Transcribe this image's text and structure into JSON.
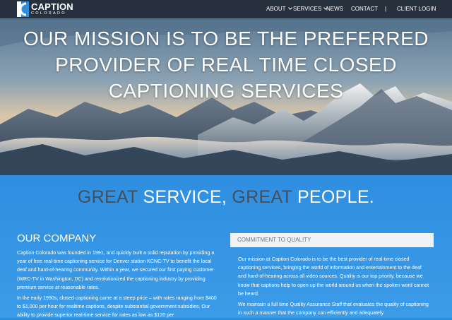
{
  "header": {
    "logo": {
      "name": "CAPTION",
      "subtitle": "COLORADO"
    },
    "nav": [
      {
        "label": "ABOUT",
        "dropdown": true
      },
      {
        "label": "SERVICES",
        "dropdown": true
      },
      {
        "label": "NEWS",
        "dropdown": false
      },
      {
        "label": "CONTACT",
        "dropdown": false
      },
      {
        "label": "|",
        "dropdown": false
      },
      {
        "label": "CLIENT LOGIN",
        "dropdown": false
      }
    ]
  },
  "hero": {
    "title": "OUR MISSION IS TO BE THE PREFERRED\nPROVIDER OF REAL TIME CLOSED\nCAPTIONING SERVICES"
  },
  "tagline": {
    "part1": "GREAT ",
    "part2": "SERVICE, ",
    "part3": "GREAT ",
    "part4": "PEOPLE."
  },
  "company": {
    "heading": "OUR COMPANY",
    "paragraphs": [
      "Caption Colorado was founded in 1991, and quickly built a solid reputation by providing a year of free real-time captioning service for Denver station KCNC-TV to benefit the local deaf and hard-of-hearing community. Within a year, we secured our first paying customer (WRC-TV in Washington, DC) and revolutionized the captioning industry by providing premium service at reasonable rates.",
      "In the early 1990s, closed captioning came at a steep price – with rates ranging from $400 to $1,000 per hour for realtime captions, despite substantial government subsidies. Our ability to provide superior real-time service for rates as low as $120 per"
    ]
  },
  "commitment": {
    "heading": "COMMITMENT TO QUALITY",
    "paragraphs": [
      "Our mission at Caption Colorado is to be the best provider of real-time closed captioning services, bringing the world of information and entertainment to the deaf and hard-of-hearing across all video sources. Quality is our top priority, because we know that captions help to open up the world around us when the spoken word cannot be heard.",
      "We maintain a full time Quality Assurance Staff that evaluates the quality of captioning in such a manner that the company can efficiently and adequately"
    ]
  },
  "colors": {
    "header_bg": "#27313d",
    "band_blue": "#2f8ee0",
    "tag_grey": "#454f5b",
    "box_bg": "#f1f2f4"
  }
}
